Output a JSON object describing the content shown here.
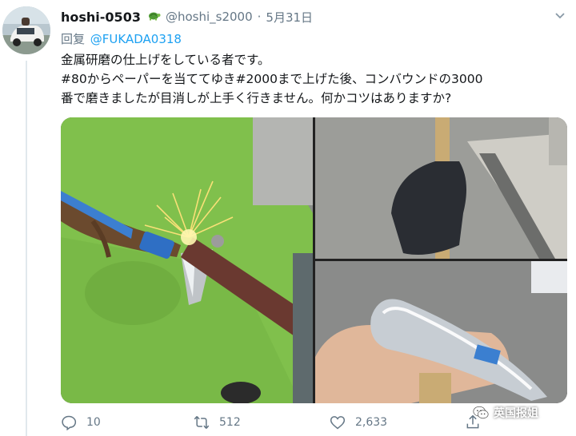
{
  "tweet": {
    "display_name": "hoshi-0503",
    "badge_icon": "turtle-icon",
    "handle": "@hoshi_s2000",
    "separator": "·",
    "date": "5月31日",
    "reply_prefix": "回复",
    "reply_mention": "@FUKADA0318",
    "body_lines": [
      "金属研磨の仕上げをしている者です。",
      "#80からペーパーを当ててゆき#2000まで上げた後、コンバウンドの3000",
      "番で磨きましたが目消しが上手く行きません。何かコツはありますか?"
    ],
    "media": [
      {
        "icon": "photo-grinding-icon",
        "description_colors": {
          "mat": "#7cc242"
        }
      },
      {
        "icon": "photo-hand-holding-tool-icon"
      },
      {
        "icon": "photo-polished-tool-icon"
      }
    ]
  },
  "actions": {
    "reply": {
      "icon": "reply-icon",
      "count": "10"
    },
    "retweet": {
      "icon": "retweet-icon",
      "count": "512"
    },
    "like": {
      "icon": "heart-icon",
      "count": "2,633"
    },
    "share": {
      "icon": "share-icon"
    }
  },
  "watermark": {
    "text": "英国报姐",
    "icon": "wechat-logo-icon"
  },
  "colors": {
    "link": "#1da1f2",
    "secondary": "#657786",
    "primary_text": "#14171a",
    "divider": "#e1e8ed"
  }
}
